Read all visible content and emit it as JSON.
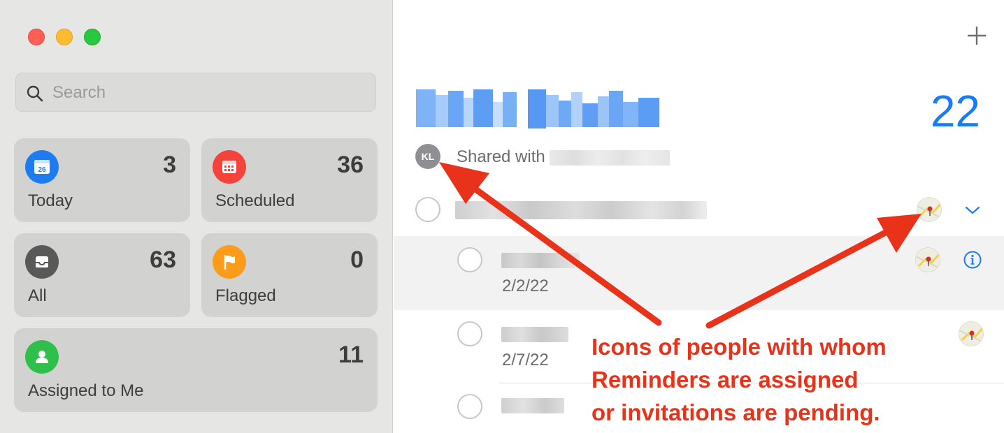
{
  "window": {
    "controls": [
      "close",
      "minimize",
      "zoom"
    ]
  },
  "sidebar": {
    "search": {
      "placeholder": "Search",
      "icon": "search-icon"
    },
    "smart_lists": [
      {
        "label": "Today",
        "count": "3",
        "icon": "calendar-today-icon",
        "icon_text": "26",
        "color": "#1e7cf2"
      },
      {
        "label": "Scheduled",
        "count": "36",
        "icon": "calendar-icon",
        "color": "#f5423a"
      },
      {
        "label": "All",
        "count": "63",
        "icon": "tray-icon",
        "color": "#595959"
      },
      {
        "label": "Flagged",
        "count": "0",
        "icon": "flag-icon",
        "color": "#fd9b1b"
      },
      {
        "label": "Assigned to Me",
        "count": "11",
        "icon": "person-icon",
        "color": "#2fbf4b"
      }
    ]
  },
  "main": {
    "add_icon": "plus-icon",
    "list_count": "22",
    "accent_color": "#1a7cf5",
    "owner_initials": "KL",
    "shared_prefix": "Shared with",
    "reminders": [
      {
        "date": "",
        "expanded": true,
        "assignee_icon": "map-avatar-icon"
      },
      {
        "date": "2/2/22",
        "selected": true,
        "assignee_icon": "map-avatar-icon",
        "info_icon": "info-icon"
      },
      {
        "date": "2/7/22",
        "assignee_icon": "map-avatar-icon"
      },
      {
        "date": ""
      }
    ]
  },
  "annotation": {
    "text": "Icons of people with whom\nReminders are assigned\nor invitations are pending.",
    "color": "#e8321a"
  }
}
